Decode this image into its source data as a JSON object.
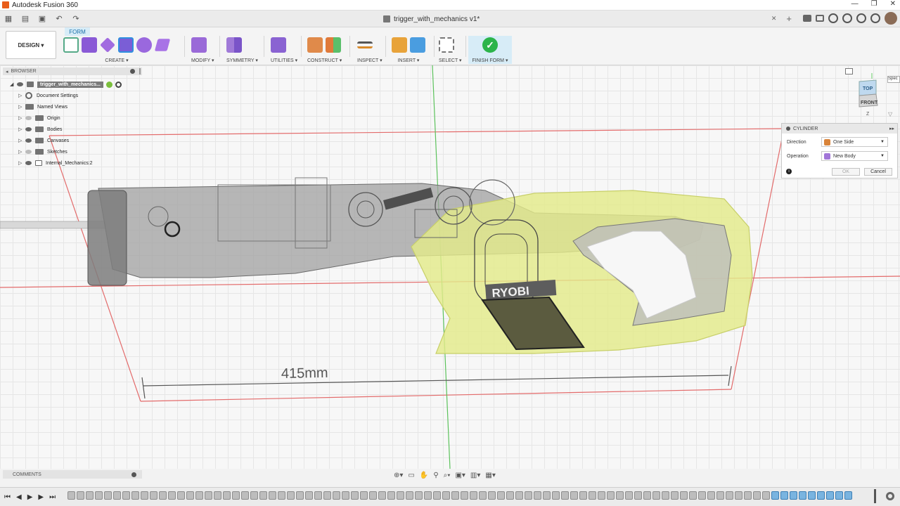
{
  "window": {
    "app_title": "Autodesk Fusion 360",
    "doc_tab": "trigger_with_mechanics v1*",
    "close_symbol": "✕",
    "win_min": "—",
    "win_max": "❐",
    "win_close": "✕"
  },
  "toolbar": {
    "workspace": "DESIGN ▾",
    "active_tab": "FORM",
    "groups": {
      "create": "CREATE ▾",
      "modify": "MODIFY ▾",
      "symmetry": "SYMMETRY ▾",
      "utilities": "UTILITIES ▾",
      "construct": "CONSTRUCT ▾",
      "inspect": "INSPECT ▾",
      "insert": "INSERT ▾",
      "select": "SELECT ▾",
      "finish": "FINISH FORM ▾"
    }
  },
  "browser": {
    "title": "BROWSER",
    "root": "trigger_with_mechanics...",
    "items": {
      "document_settings": "Document Settings",
      "named_views": "Named Views",
      "origin": "Origin",
      "bodies": "Bodies",
      "canvases": "Canvases",
      "sketches": "Sketches",
      "internal_mechanics": "Internal_Mechanics:2"
    }
  },
  "viewport": {
    "dimension_label": "415mm",
    "brand_text": "RYOBI",
    "colors": {
      "body_highlight": "#e3ea8a",
      "housing_grey": "#8f8f8f",
      "selection_plane": "#5b5b3f",
      "grid_red": "#e36b6b",
      "axis_green": "#5cc25c"
    }
  },
  "viewcube": {
    "top": "TOP",
    "front": "FRONT",
    "tooltip_fragment": "Spec"
  },
  "cylinder_panel": {
    "title": "CYLINDER",
    "direction_label": "Direction",
    "direction_value": "One Side",
    "operation_label": "Operation",
    "operation_value": "New Body",
    "ok_label": "OK",
    "cancel_label": "Cancel"
  },
  "comments": {
    "title": "COMMENTS"
  }
}
